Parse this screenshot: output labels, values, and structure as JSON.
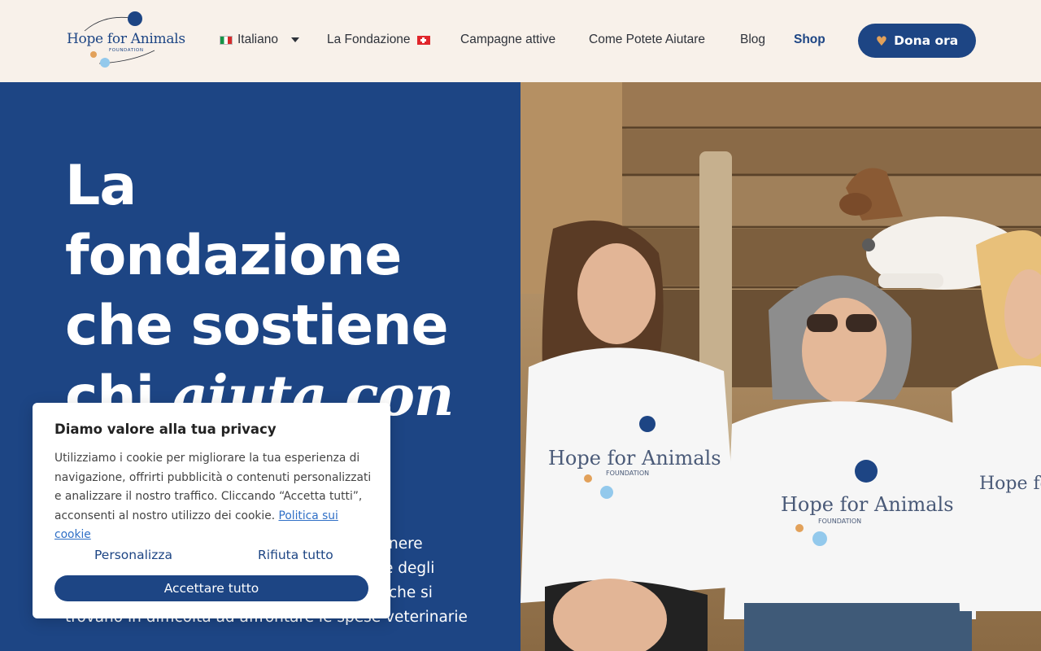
{
  "header": {
    "logo_text": "Hope for Animals",
    "logo_sub": "FOUNDATION",
    "nav": {
      "language": "Italiano",
      "foundation": "La Fondazione",
      "campaigns": "Campagne attive",
      "help": "Come Potete Aiutare",
      "blog": "Blog",
      "shop": "Shop"
    },
    "donate_label": "Dona ora"
  },
  "hero": {
    "title_line1": "La",
    "title_line2": "fondazione",
    "title_line3": "che sostiene",
    "title_line4_plain": "chi ",
    "title_line4_italic": "aiuta con",
    "body_line1": "nere",
    "body_line2": "e degli",
    "body_line3": "che si",
    "body_line4": "trovano in difficoltà ad affrontare le spese veterinarie",
    "shirt_text": "Hope for Animals",
    "shirt_sub": "FOUNDATION"
  },
  "cookie": {
    "title": "Diamo valore alla tua privacy",
    "text": "Utilizziamo i cookie per migliorare la tua esperienza di navigazione, offrirti pubblicità o contenuti personalizzati e analizzare il nostro traffico. Cliccando “Accetta tutti”, acconsenti al nostro utilizzo dei cookie.",
    "policy_link": "Politica sui cookie",
    "customize": "Personalizza",
    "reject": "Rifiuta tutto",
    "accept": "Accettare tutto"
  },
  "colors": {
    "brand_blue": "#1d4584",
    "background": "#f8f1ea",
    "accent_orange": "#e2a15a",
    "link_blue": "#2f6fc6"
  }
}
